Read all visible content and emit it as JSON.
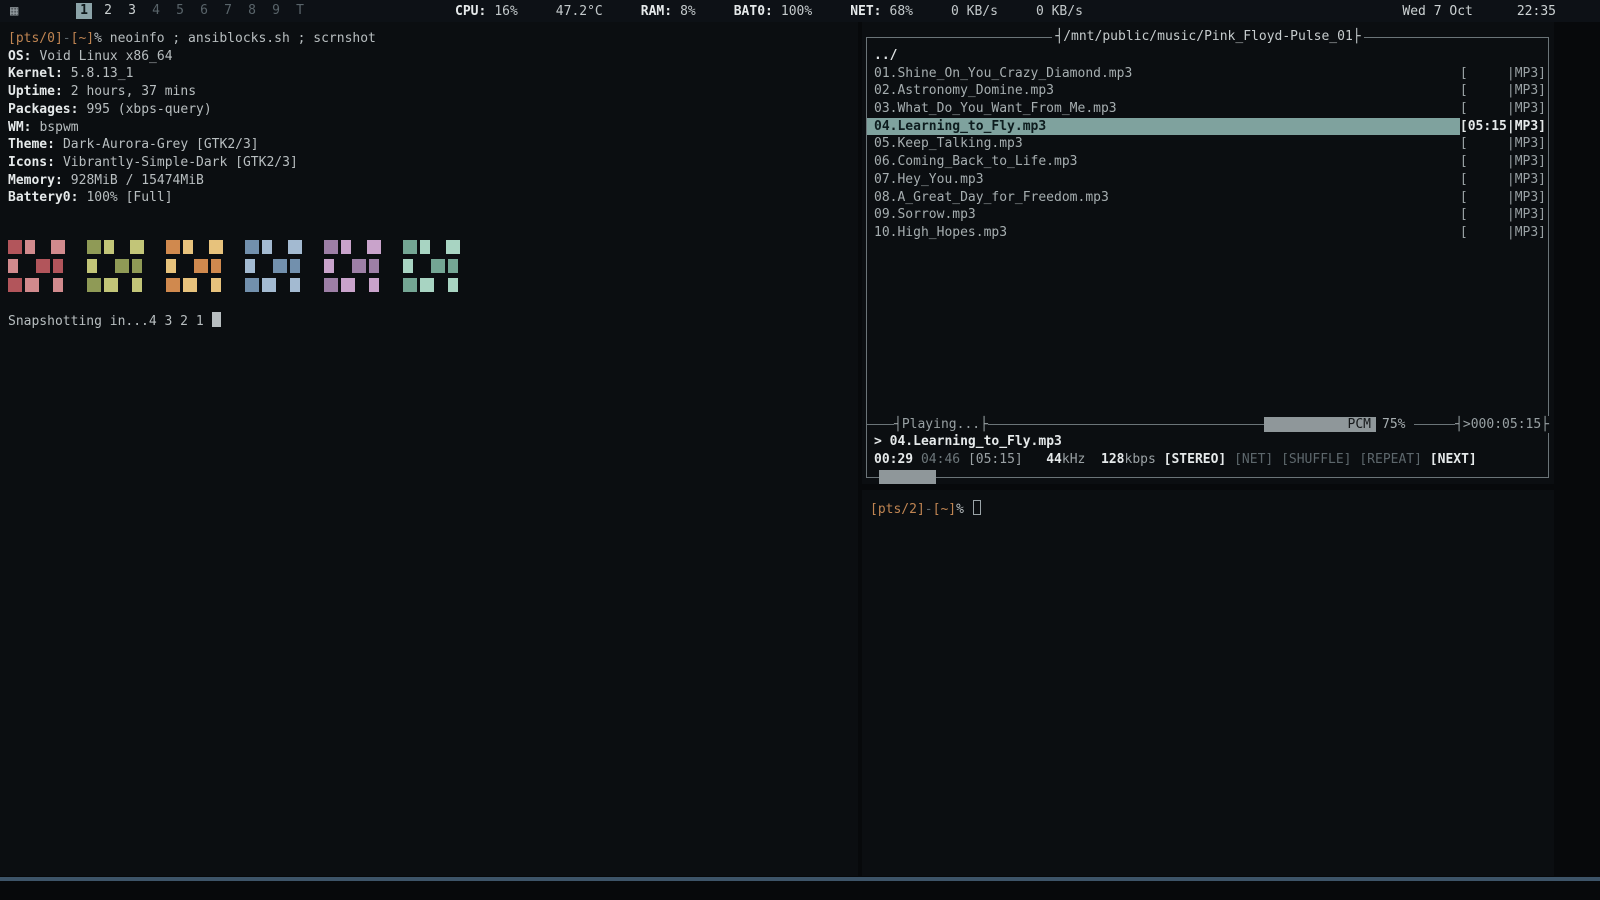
{
  "bar": {
    "menu_icon": "grid",
    "workspaces": [
      {
        "label": "1",
        "state": "active"
      },
      {
        "label": "2",
        "state": "occupied"
      },
      {
        "label": "3",
        "state": "occupied"
      },
      {
        "label": "4",
        "state": "free"
      },
      {
        "label": "5",
        "state": "free"
      },
      {
        "label": "6",
        "state": "free"
      },
      {
        "label": "7",
        "state": "free"
      },
      {
        "label": "8",
        "state": "free"
      },
      {
        "label": "9",
        "state": "free"
      },
      {
        "label": "T",
        "state": "free"
      }
    ],
    "stats": [
      {
        "label": "CPU:",
        "value": "16%"
      },
      {
        "label": "",
        "value": "47.2°C"
      },
      {
        "label": "RAM:",
        "value": "8%"
      },
      {
        "label": "BAT0:",
        "value": "100%"
      },
      {
        "label": "NET:",
        "value": "68%"
      },
      {
        "label": "",
        "value": "0 KB/s"
      },
      {
        "label": "",
        "value": "0 KB/s"
      }
    ],
    "date": "Wed 7 Oct",
    "time": "22:35"
  },
  "terminal_left": {
    "prompt_pts": "[pts/0]",
    "prompt_sep": "-",
    "prompt_cwd": "[~]",
    "prompt_sigil": "%",
    "command": "neoinfo ; ansiblocks.sh ; scrnshot",
    "info": [
      {
        "label": "OS:",
        "value": "Void Linux x86_64"
      },
      {
        "label": "Kernel:",
        "value": "5.8.13_1"
      },
      {
        "label": "Uptime:",
        "value": "2 hours, 37 mins"
      },
      {
        "label": "Packages:",
        "value": "995 (xbps-query)"
      },
      {
        "label": "WM:",
        "value": "bspwm"
      },
      {
        "label": "Theme:",
        "value": "Dark-Aurora-Grey [GTK2/3]"
      },
      {
        "label": "Icons:",
        "value": "Vibrantly-Simple-Dark [GTK2/3]"
      },
      {
        "label": "Memory:",
        "value": "928MiB / 15474MiB"
      },
      {
        "label": "Battery0:",
        "value": "100% [Full]"
      }
    ],
    "color_groups": [
      {
        "name": "red",
        "shades": [
          "#b2555b",
          "#d18a8d"
        ]
      },
      {
        "name": "green",
        "shades": [
          "#8f9a56",
          "#c2c578"
        ]
      },
      {
        "name": "orange",
        "shades": [
          "#d0894e",
          "#e7c27c"
        ]
      },
      {
        "name": "blue",
        "shades": [
          "#7290ad",
          "#a3bad1"
        ]
      },
      {
        "name": "purple",
        "shades": [
          "#9d7fa6",
          "#c9a3cb"
        ]
      },
      {
        "name": "teal",
        "shades": [
          "#74a694",
          "#a8d4c2"
        ]
      }
    ],
    "countdown": "Snapshotting in...4 3 2 1 "
  },
  "player": {
    "title_text": "┤/mnt/public/music/Pink_Floyd-Pulse_01├",
    "parent_dir": "../",
    "tracks": [
      {
        "name": "01.Shine_On_You_Crazy_Diamond.mp3",
        "meta": "[     |MP3]"
      },
      {
        "name": "02.Astronomy_Domine.mp3",
        "meta": "[     |MP3]"
      },
      {
        "name": "03.What_Do_You_Want_From_Me.mp3",
        "meta": "[     |MP3]"
      },
      {
        "name": "04.Learning_to_Fly.mp3",
        "meta": "[05:15|MP3]"
      },
      {
        "name": "05.Keep_Talking.mp3",
        "meta": "[     |MP3]"
      },
      {
        "name": "06.Coming_Back_to_Life.mp3",
        "meta": "[     |MP3]"
      },
      {
        "name": "07.Hey_You.mp3",
        "meta": "[     |MP3]"
      },
      {
        "name": "08.A_Great_Day_for_Freedom.mp3",
        "meta": "[     |MP3]"
      },
      {
        "name": "09.Sorrow.mp3",
        "meta": "[     |MP3]"
      },
      {
        "name": "10.High_Hopes.mp3",
        "meta": "[     |MP3]"
      }
    ],
    "state_text": "┤Playing...├",
    "mixer_label": "PCM",
    "mixer_percent": "75%",
    "total_text": "┤>000:05:15├",
    "now_prefix": ">",
    "now_playing": "04.Learning_to_Fly.mp3",
    "time_elapsed": "00:29",
    "time_left": "04:46",
    "time_total": "[05:15]",
    "rate": "44",
    "rate_unit": "kHz",
    "bitrate": "128",
    "bitrate_unit": "kbps",
    "flags": [
      {
        "label": "[STEREO]",
        "on": true
      },
      {
        "label": "[NET]",
        "on": false
      },
      {
        "label": "[SHUFFLE]",
        "on": false
      },
      {
        "label": "[REPEAT]",
        "on": false
      },
      {
        "label": "[NEXT]",
        "on": true
      }
    ]
  },
  "terminal_bottom": {
    "prompt_pts": "[pts/2]",
    "prompt_sep": "-",
    "prompt_cwd": "[~]",
    "prompt_sigil": "%"
  }
}
